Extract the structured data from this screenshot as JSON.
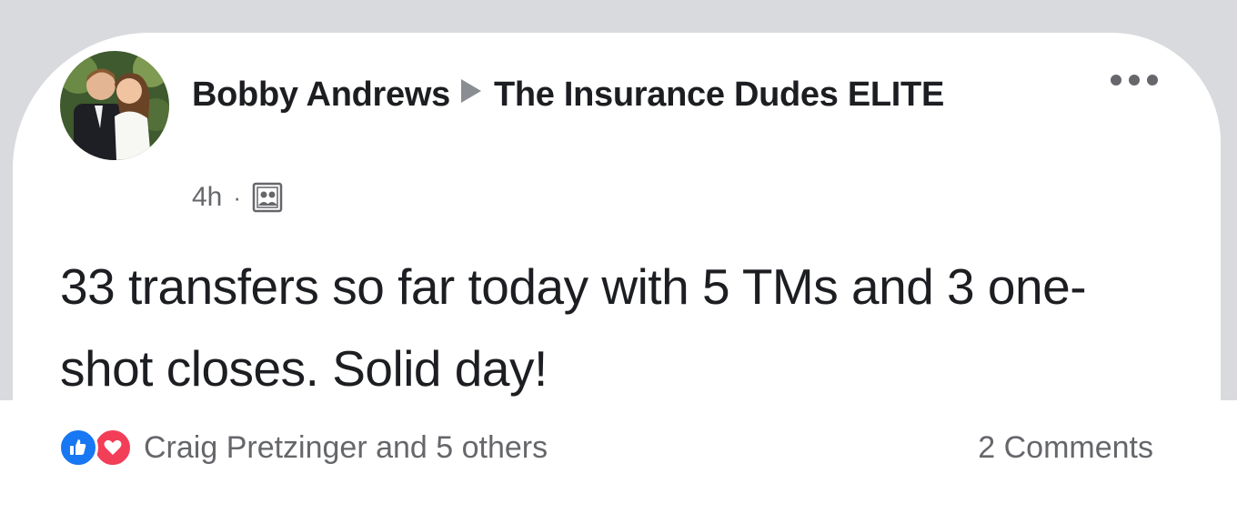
{
  "post": {
    "author": "Bobby Andrews",
    "group": "The Insurance Dudes ELITE",
    "time": "4h",
    "separator": "·",
    "audience_icon": "group-icon",
    "text": "33 transfers so far today with 5 TMs and 3 one-shot closes. Solid day!"
  },
  "menu": {
    "icon": "more-options-icon"
  },
  "engagement": {
    "reactions": [
      "like-icon",
      "love-icon"
    ],
    "reactions_summary": "Craig Pretzinger and 5 others",
    "comments": "2 Comments"
  },
  "colors": {
    "primary_text": "#1c1e21",
    "secondary_text": "#65676b",
    "like_blue": "#1877f2",
    "love_red": "#f33e58",
    "backdrop": "#d9dadd"
  }
}
